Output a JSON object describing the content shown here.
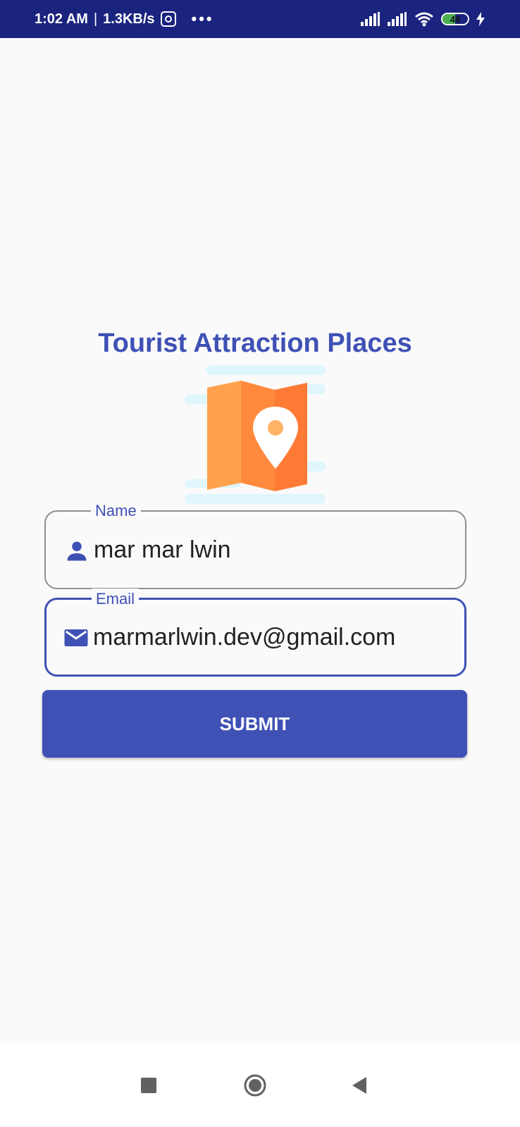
{
  "status_bar": {
    "time": "1:02 AM",
    "separator": "|",
    "net_speed": "1.3KB/s",
    "more": "•••",
    "battery_level": "49",
    "battery_fraction": 0.49,
    "icons": [
      "signal-icon",
      "signal-icon",
      "wifi-icon",
      "battery-icon",
      "charging-icon"
    ]
  },
  "header": {
    "title": "Tourist Attraction Places",
    "logo_icon": "map-pin-icon"
  },
  "form": {
    "name_field": {
      "label": "Name",
      "value": "mar mar lwin",
      "icon": "person-icon"
    },
    "email_field": {
      "label": "Email",
      "value": "marmarlwin.dev@gmail.com",
      "icon": "mail-icon"
    },
    "submit_label": "SUBMIT"
  },
  "nav_bar": {
    "buttons": [
      "recents-icon",
      "home-icon",
      "back-icon"
    ]
  },
  "colors": {
    "primary": "#3f51b5",
    "status_bar": "#1a237e",
    "background": "#fafafa"
  }
}
